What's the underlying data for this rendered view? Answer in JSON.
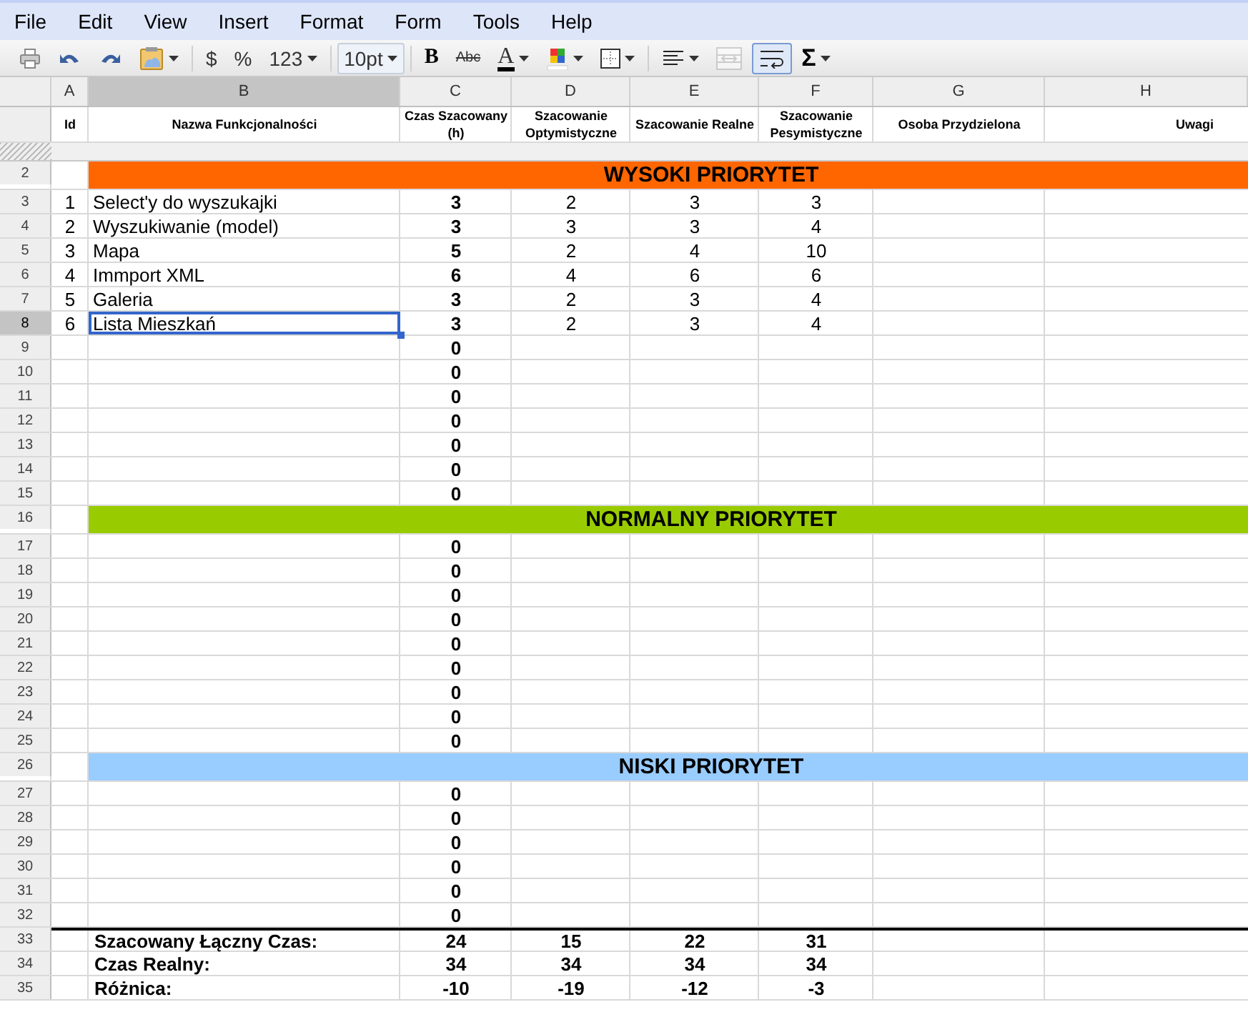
{
  "menu": [
    "File",
    "Edit",
    "View",
    "Insert",
    "Format",
    "Form",
    "Tools",
    "Help"
  ],
  "toolbar": [
    {
      "items": [
        {
          "kind": "print",
          "pressed": false,
          "disabled": false
        },
        {
          "kind": "undo",
          "pressed": false,
          "disabled": false
        },
        {
          "kind": "redo",
          "pressed": false,
          "disabled": false
        },
        {
          "kind": "paste",
          "pressed": false,
          "disabled": false
        }
      ]
    },
    {
      "items": [
        {
          "kind": "text",
          "label": "$",
          "pressed": false,
          "disabled": false
        },
        {
          "kind": "text",
          "label": "%",
          "pressed": false,
          "disabled": false
        },
        {
          "kind": "textmenu",
          "label": "123",
          "pressed": false,
          "disabled": false
        }
      ]
    },
    {
      "items": [
        {
          "kind": "dropdown",
          "label": "10pt",
          "pressed": false,
          "disabled": false
        }
      ]
    },
    {
      "items": [
        {
          "kind": "bold",
          "label": "B",
          "pressed": false,
          "disabled": false
        },
        {
          "kind": "strike",
          "label": "Abc",
          "pressed": false,
          "disabled": false
        },
        {
          "kind": "textcolor",
          "label": "A",
          "pressed": false,
          "disabled": false
        },
        {
          "kind": "fillcolor",
          "pressed": false,
          "disabled": false
        },
        {
          "kind": "borders",
          "pressed": false,
          "disabled": false
        }
      ]
    },
    {
      "items": [
        {
          "kind": "align",
          "pressed": false,
          "disabled": false
        },
        {
          "kind": "merge",
          "pressed": false,
          "disabled": true
        },
        {
          "kind": "wrap",
          "pressed": true,
          "disabled": false
        },
        {
          "kind": "textmenu",
          "label": "Σ",
          "pressed": false,
          "disabled": false
        }
      ]
    }
  ],
  "columns": [
    {
      "letter": "A",
      "selected": false
    },
    {
      "letter": "B",
      "selected": true
    },
    {
      "letter": "C",
      "selected": false
    },
    {
      "letter": "D",
      "selected": false
    },
    {
      "letter": "E",
      "selected": false
    },
    {
      "letter": "F",
      "selected": false
    },
    {
      "letter": "G",
      "selected": false
    },
    {
      "letter": "H",
      "selected": false
    }
  ],
  "header": [
    "Id",
    "Nazwa Funkcjonalności",
    "Czas Szacowany (h)",
    "Szacowanie Optymistyczne",
    "Szacowanie Realne",
    "Szacowanie Pesymistyczne",
    "Osoba Przydzielona",
    "Uwagi"
  ],
  "rows": [
    {
      "num": "2",
      "kind": "section",
      "title": "WYSOKI PRIORYTET",
      "color": "#ff6600",
      "selected": false
    },
    {
      "num": "3",
      "kind": "item",
      "id": "1",
      "name": "Select'y do wyszukajki",
      "values": [
        "3",
        "2",
        "3",
        "3"
      ],
      "selected": false
    },
    {
      "num": "4",
      "kind": "item",
      "id": "2",
      "name": "Wyszukiwanie (model)",
      "values": [
        "3",
        "3",
        "3",
        "4"
      ],
      "selected": false
    },
    {
      "num": "5",
      "kind": "item",
      "id": "3",
      "name": "Mapa",
      "values": [
        "5",
        "2",
        "4",
        "10"
      ],
      "selected": false
    },
    {
      "num": "6",
      "kind": "item",
      "id": "4",
      "name": "Immport XML",
      "values": [
        "6",
        "4",
        "6",
        "6"
      ],
      "selected": false
    },
    {
      "num": "7",
      "kind": "item",
      "id": "5",
      "name": "Galeria",
      "values": [
        "3",
        "2",
        "3",
        "4"
      ],
      "selected": false
    },
    {
      "num": "8",
      "kind": "item",
      "id": "6",
      "name": "Lista Mieszkań",
      "values": [
        "3",
        "2",
        "3",
        "4"
      ],
      "selected": true
    },
    {
      "num": "9",
      "kind": "blank",
      "total": "0",
      "selected": false
    },
    {
      "num": "10",
      "kind": "blank",
      "total": "0",
      "selected": false
    },
    {
      "num": "11",
      "kind": "blank",
      "total": "0",
      "selected": false
    },
    {
      "num": "12",
      "kind": "blank",
      "total": "0",
      "selected": false
    },
    {
      "num": "13",
      "kind": "blank",
      "total": "0",
      "selected": false
    },
    {
      "num": "14",
      "kind": "blank",
      "total": "0",
      "selected": false
    },
    {
      "num": "15",
      "kind": "blank",
      "total": "0",
      "selected": false
    },
    {
      "num": "16",
      "kind": "section",
      "title": "NORMALNY PRIORYTET",
      "color": "#99cc00",
      "selected": false
    },
    {
      "num": "17",
      "kind": "blank",
      "total": "0",
      "selected": false
    },
    {
      "num": "18",
      "kind": "blank",
      "total": "0",
      "selected": false
    },
    {
      "num": "19",
      "kind": "blank",
      "total": "0",
      "selected": false
    },
    {
      "num": "20",
      "kind": "blank",
      "total": "0",
      "selected": false
    },
    {
      "num": "21",
      "kind": "blank",
      "total": "0",
      "selected": false
    },
    {
      "num": "22",
      "kind": "blank",
      "total": "0",
      "selected": false
    },
    {
      "num": "23",
      "kind": "blank",
      "total": "0",
      "selected": false
    },
    {
      "num": "24",
      "kind": "blank",
      "total": "0",
      "selected": false
    },
    {
      "num": "25",
      "kind": "blank",
      "total": "0",
      "selected": false
    },
    {
      "num": "26",
      "kind": "section",
      "title": "NISKI PRIORYTET",
      "color": "#99ccff",
      "selected": false
    },
    {
      "num": "27",
      "kind": "blank",
      "total": "0",
      "selected": false
    },
    {
      "num": "28",
      "kind": "blank",
      "total": "0",
      "selected": false
    },
    {
      "num": "29",
      "kind": "blank",
      "total": "0",
      "selected": false
    },
    {
      "num": "30",
      "kind": "blank",
      "total": "0",
      "selected": false
    },
    {
      "num": "31",
      "kind": "blank",
      "total": "0",
      "selected": false
    },
    {
      "num": "32",
      "kind": "blank",
      "total": "0",
      "selected": false
    },
    {
      "num": "33",
      "kind": "summary",
      "label": "Szacowany Łączny Czas:",
      "values": [
        "24",
        "15",
        "22",
        "31"
      ],
      "selected": false
    },
    {
      "num": "34",
      "kind": "summary",
      "label": "Czas Realny:",
      "values": [
        "34",
        "34",
        "34",
        "34"
      ],
      "selected": false
    },
    {
      "num": "35",
      "kind": "summary",
      "label": "Różnica:",
      "values": [
        "-10",
        "-19",
        "-12",
        "-3"
      ],
      "selected": false
    }
  ]
}
